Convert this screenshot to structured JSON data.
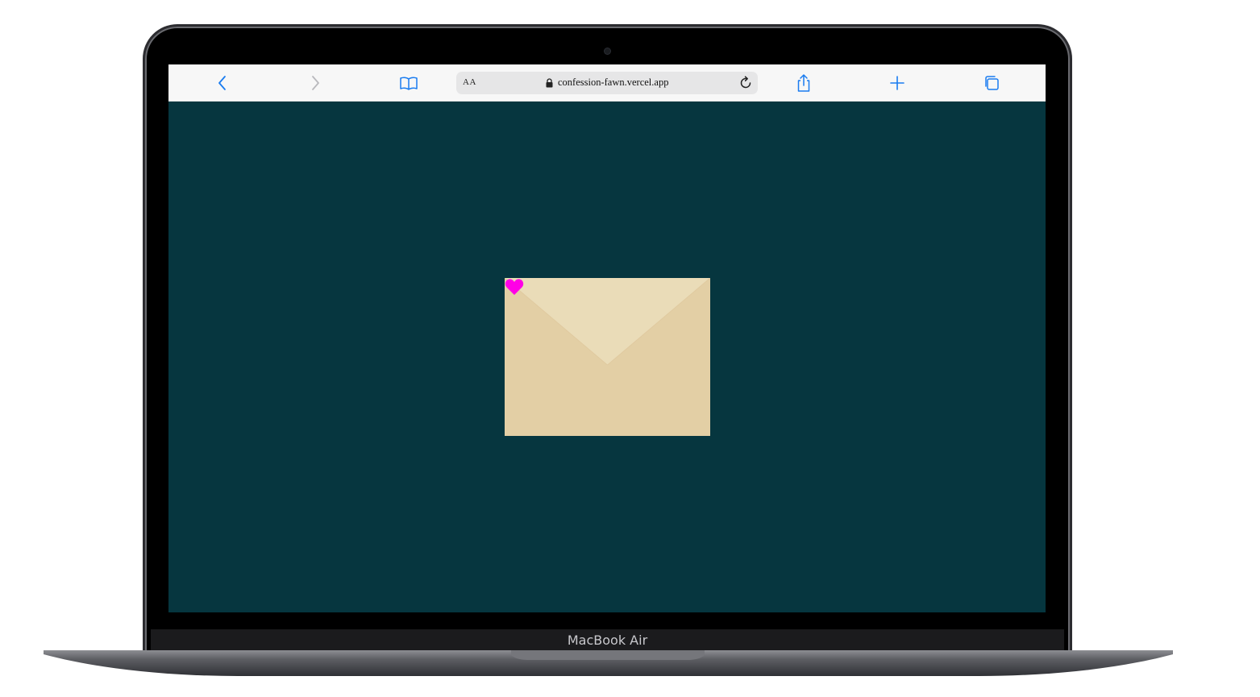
{
  "browser": {
    "address_bar": {
      "reader_label": "AA",
      "url": "confession-fawn.vercel.app"
    },
    "icons": [
      "back-icon",
      "forward-icon",
      "bookmarks-icon",
      "lock-icon",
      "reload-icon",
      "share-icon",
      "new-tab-icon",
      "tabs-icon"
    ]
  },
  "page": {
    "background": "#06363f",
    "envelope_color": "#e3cfa5",
    "flap_color": "#eadcb8",
    "heart_color": "#ff00e6"
  },
  "device": {
    "label": "MacBook Air"
  }
}
